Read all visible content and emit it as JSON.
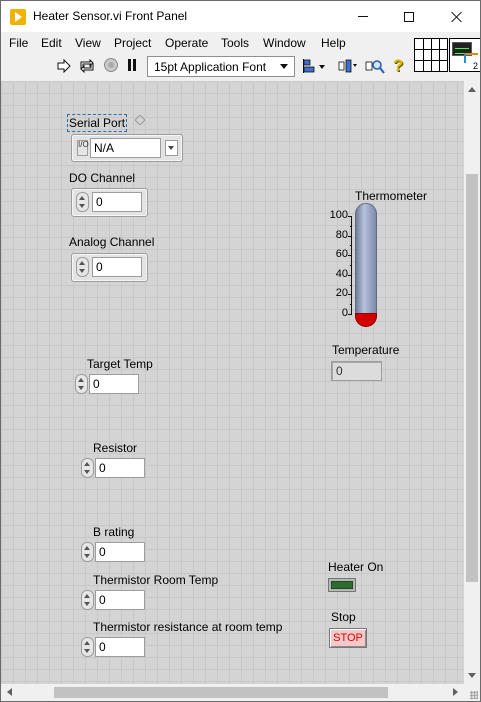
{
  "window": {
    "title": "Heater Sensor.vi Front Panel"
  },
  "menu": {
    "items": [
      "File",
      "Edit",
      "View",
      "Project",
      "Operate",
      "Tools",
      "Window",
      "Help"
    ]
  },
  "toolbar": {
    "font_select": "15pt Application Font",
    "help_glyph": "?"
  },
  "connector": {
    "icon_number": "2"
  },
  "controls": {
    "serial_port": {
      "label": "Serial Port",
      "value": "N/A",
      "visa_glyph": "I/O"
    },
    "do_channel": {
      "label": "DO Channel",
      "value": "0"
    },
    "analog_channel": {
      "label": "Analog Channel",
      "value": "0"
    },
    "target_temp": {
      "label": "Target Temp",
      "value": "0"
    },
    "resistor": {
      "label": "Resistor",
      "value": "0"
    },
    "b_rating": {
      "label": "B rating",
      "value": "0"
    },
    "thermistor_room_temp": {
      "label": "Thermistor Room Temp",
      "value": "0"
    },
    "thermistor_resistance": {
      "label": "Thermistor resistance at room temp",
      "value": "0"
    }
  },
  "indicators": {
    "thermometer": {
      "label": "Thermometer",
      "ticks": [
        "100",
        "80",
        "60",
        "40",
        "20",
        "0"
      ],
      "scale_min": 0,
      "scale_max": 100,
      "value": 0,
      "tube_color": "#7c89a8",
      "fill_color": "#d40000"
    },
    "temperature": {
      "label": "Temperature",
      "value": "0"
    },
    "heater_on": {
      "label": "Heater On",
      "state": "off",
      "led_color": "#1f4a1f"
    },
    "stop": {
      "label": "Stop",
      "button_text": "STOP",
      "text_color": "#e00000"
    }
  }
}
